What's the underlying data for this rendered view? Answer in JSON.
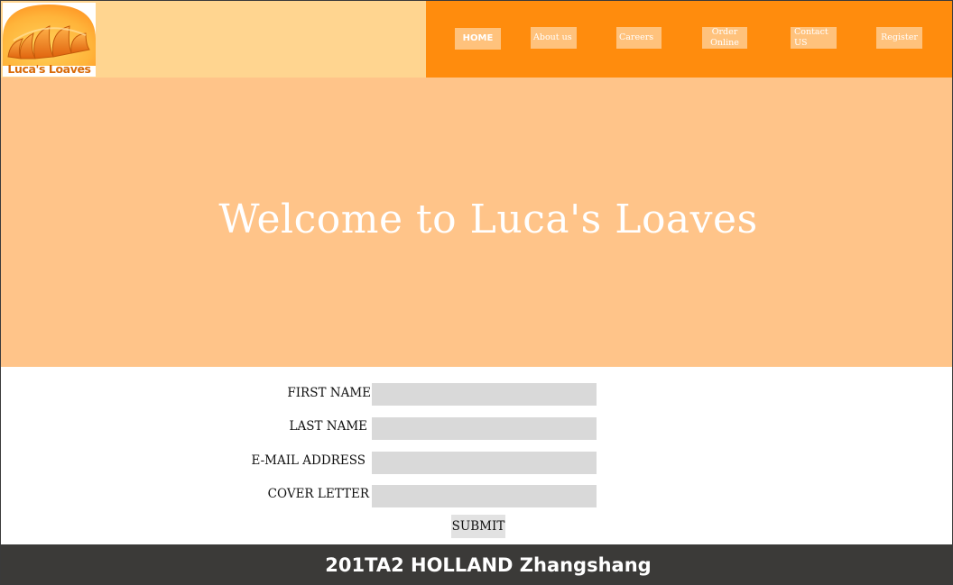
{
  "brand": {
    "logo_text": "Luca's Loaves"
  },
  "nav": {
    "home": "HOME",
    "about": "About us",
    "careers": "Careers",
    "order": "Order Online",
    "contact": "Contact US",
    "register": "Register"
  },
  "hero": {
    "title": "Welcome to Luca's Loaves"
  },
  "form": {
    "first_name_label": "FIRST NAME",
    "last_name_label": "LAST NAME",
    "email_label": "E-MAIL ADDRESS",
    "cover_letter_label": "COVER LETTER",
    "first_name_value": "",
    "last_name_value": "",
    "email_value": "",
    "cover_letter_value": "",
    "submit_label": "SUBMIT"
  },
  "footer": {
    "text": "201TA2 HOLLAND Zhangshang"
  },
  "colors": {
    "header_light": "#ffd590",
    "header_orange": "#ff8c0d",
    "nav_button": "#ffc27c",
    "hero_bg": "#ffc489",
    "input_bg": "#d9d9d9",
    "footer_bg": "#3b3a38"
  },
  "icons": {
    "logo_image": "croissant-icon"
  }
}
